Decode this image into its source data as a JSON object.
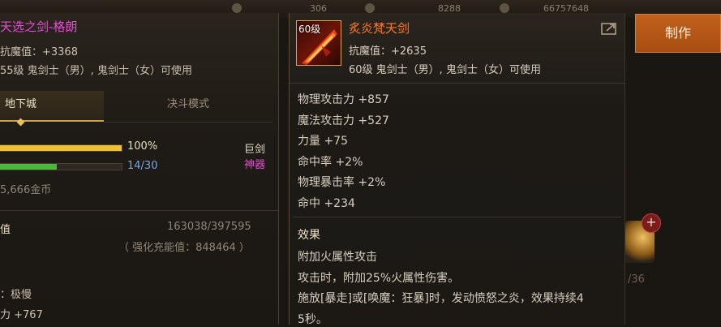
{
  "topbar": {
    "currency_1": "306",
    "currency_2": "8288",
    "currency_3": "66757648"
  },
  "left_panel": {
    "title": "天选之剑-格朗",
    "anti_magic": "抗魔值：+3368",
    "usage": "55级 鬼剑士（男）, 鬼剑士（女）可使用",
    "tabs": {
      "dungeon": "地下城",
      "duel": "决斗模式"
    },
    "bar1": {
      "value_text": "100%",
      "fill": 1.0,
      "color": "#f0c030"
    },
    "bar2": {
      "value_text": "14/30",
      "fill": 0.4667,
      "color": "#4ab83a"
    },
    "type_label": "巨剑",
    "rarity_label": "神器",
    "gold": "5,666金币",
    "value_label": "值",
    "value_numbers": "163038/397595",
    "enhance_note": "（ 强化充能值：848464 ）",
    "speed": "：极慢",
    "power": "力 +767"
  },
  "right_panel": {
    "level_badge": "60级",
    "item_name": "炙炎梵天剑",
    "anti_magic": "抗魔值：+2635",
    "usage": "60级 鬼剑士（男）, 鬼剑士（女）可使用",
    "stats": [
      "物理攻击力 +857",
      "魔法攻击力 +527",
      "力量 +75",
      "命中率 +2%",
      "物理暴击率 +2%",
      "命中 +234"
    ],
    "effect_title": "效果",
    "effect_lines": [
      "附加火属性攻击",
      "攻击时，附加25%火属性伤害。",
      "施放[暴走]或[唤魔：狂暴]时，发动愤怒之炎，效果持续4",
      "5秒。"
    ]
  },
  "make_button": "制作",
  "side_fraction": "/36",
  "plus_symbol": "+"
}
